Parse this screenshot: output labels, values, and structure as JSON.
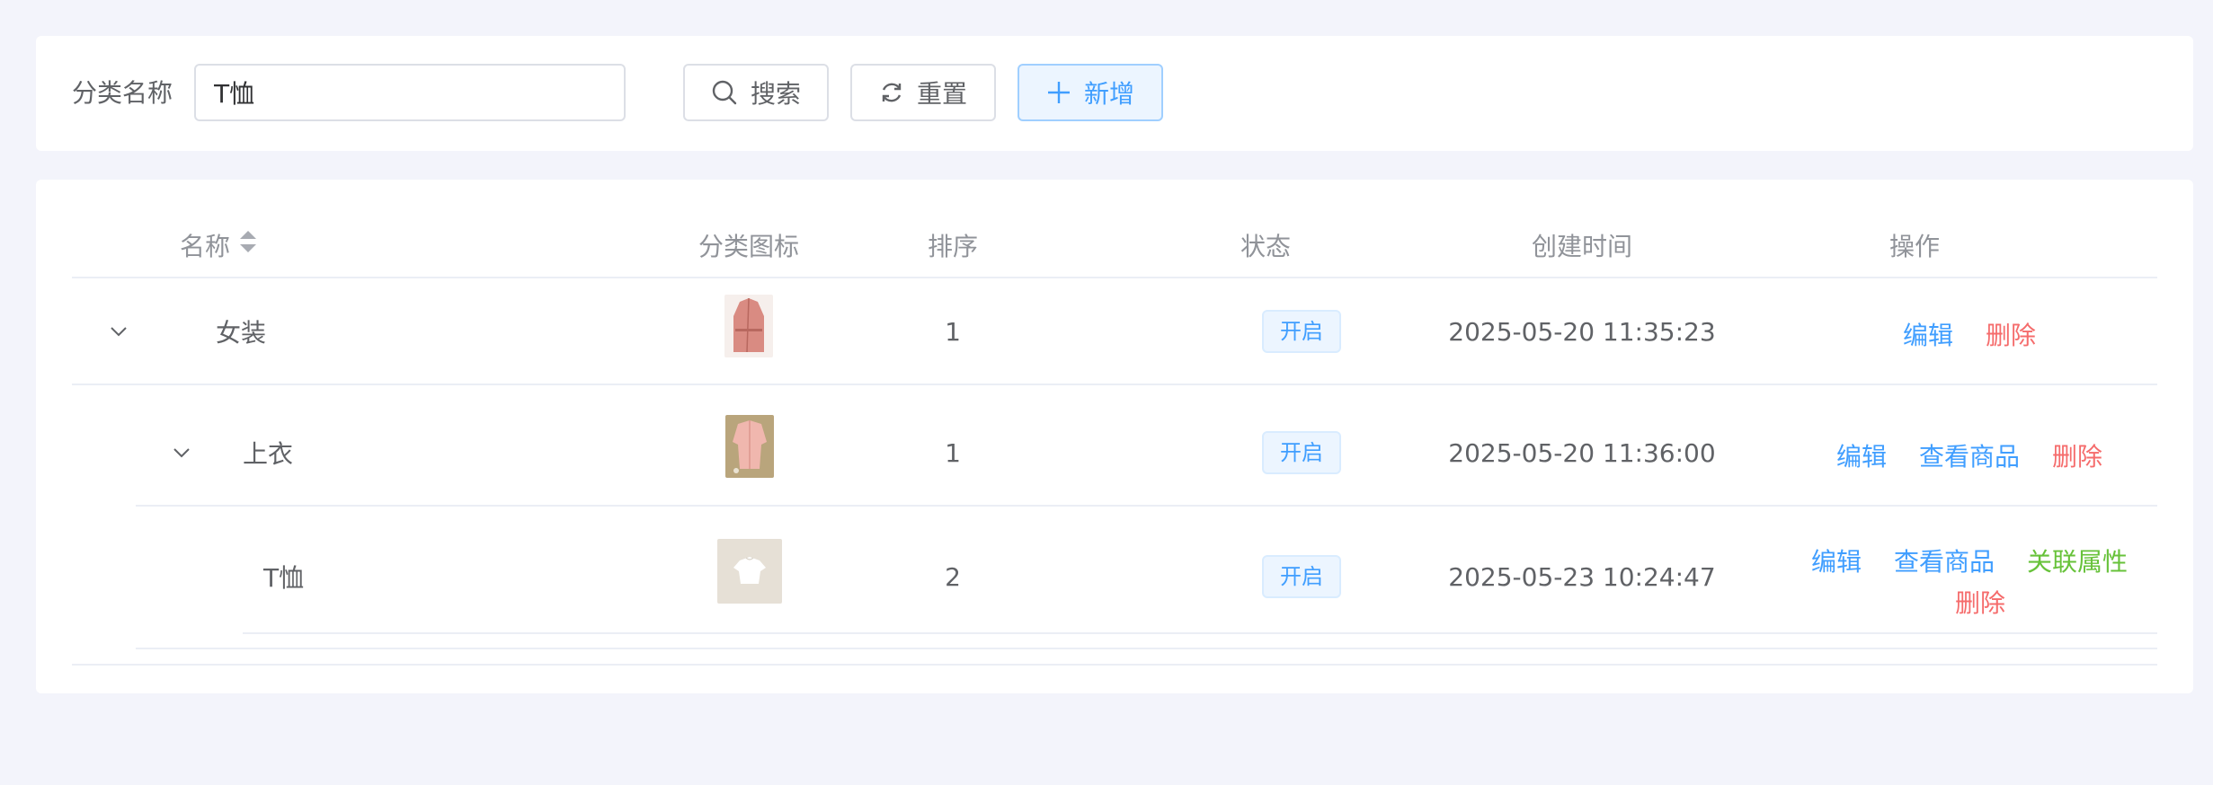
{
  "search": {
    "label": "分类名称",
    "value": "T恤",
    "search_button": "搜索",
    "reset_button": "重置",
    "add_button": "新增"
  },
  "table": {
    "columns": {
      "name": "名称",
      "icon": "分类图标",
      "sort": "排序",
      "status": "状态",
      "created": "创建时间",
      "actions": "操作"
    },
    "rows": [
      {
        "name": "女装",
        "sort": "1",
        "status": "开启",
        "created": "2025-05-20 11:35:23",
        "icon": "pink-coat-thumbnail",
        "actions": {
          "edit": "编辑",
          "delete": "删除"
        }
      },
      {
        "name": "上衣",
        "sort": "1",
        "status": "开启",
        "created": "2025-05-20 11:36:00",
        "icon": "pink-shirt-thumbnail",
        "actions": {
          "edit": "编辑",
          "view": "查看商品",
          "delete": "删除"
        }
      },
      {
        "name": "T恤",
        "sort": "2",
        "status": "开启",
        "created": "2025-05-23 10:24:47",
        "icon": "white-tshirt-thumbnail",
        "actions": {
          "edit": "编辑",
          "view": "查看商品",
          "link_attr": "关联属性",
          "delete": "删除"
        }
      }
    ]
  },
  "colors": {
    "primary": "#409eff",
    "danger": "#f56c6c",
    "success": "#67c23a",
    "background": "#f3f4fb"
  }
}
